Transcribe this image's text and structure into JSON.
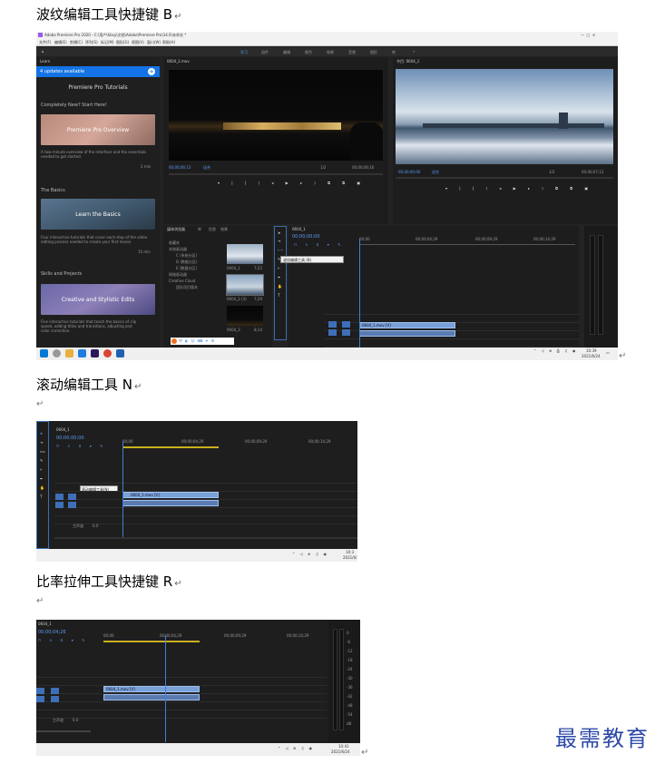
{
  "headings": {
    "first": "波纹编辑工具快捷键 B",
    "second": "滚动编辑工具 N",
    "third": "比率拉伸工具快捷键 R"
  },
  "para_mark": "↵",
  "screenshot1": {
    "window_title": "Adobe Premiere Pro 2020 - C:\\用户\\hbsy\\文档\\Adobe\\Premiere Pro\\14.0\\未命名 *",
    "menu": [
      "文件(F)",
      "编辑(E)",
      "剪辑(C)",
      "序列(S)",
      "标记(M)",
      "图形(G)",
      "视图(V)",
      "窗口(W)",
      "帮助(H)"
    ],
    "workspace_tabs": [
      "学习",
      "组件",
      "编辑",
      "颜色",
      "效果",
      "音频",
      "图形",
      "库"
    ],
    "learn_panel": {
      "tab": "Learn",
      "updates": "4 updates available",
      "title": "Premiere Pro Tutorials",
      "section1": "Completely New? Start Here!",
      "card1_title": "Premiere Pro Overview",
      "card1_desc": "A two-minute overview of the interface and the essentials needed to get started.",
      "card1_time": "2 min",
      "section2": "The Basics",
      "card2_title": "Learn the Basics",
      "card2_desc": "Four interactive tutorials that cover each step of the video editing process needed to create your first movie.",
      "card2_time": "15 min",
      "section3": "Skills and Projects",
      "card3_title": "Creative and Stylistic Edits",
      "card3_desc": "Five interactive tutorials that teach the basics of clip speed, adding titles and transitions, adjusting and color correction."
    },
    "source_monitor": {
      "tab": "0604_2.mov",
      "timecode_left": "00;00;06;13",
      "fit": "适合",
      "scale": "1/2",
      "timecode_right": "00;00;06;16"
    },
    "program_monitor": {
      "tab": "节目: 0604_1",
      "timecode_left": "00;00;00;00",
      "fit": "适合",
      "scale": "1/2",
      "timecode_right": "00;00;07;12"
    },
    "project_panel": {
      "tabs": [
        "媒体浏览器",
        "库",
        "信息",
        "效果"
      ],
      "items": [
        "收藏夹",
        "本地驱动器",
        "C (系统分区)",
        "D (数据分区)",
        "E (数据分区)",
        "网络驱动器",
        "Creative Cloud",
        "团队项目版本"
      ],
      "thumbs": [
        {
          "name": "0604_1",
          "duration": "7;22"
        },
        {
          "name": "0604_2 (3)",
          "duration": "7;29"
        },
        {
          "name": "0604_3",
          "duration": "8;14"
        }
      ]
    },
    "timeline": {
      "tab": "0604_1",
      "timecode": "00;00;00;00",
      "ruler": [
        "00;00",
        "00;00;04;29",
        "00;00;09;29",
        "00;00;14;29"
      ],
      "tooltip": "波纹编辑工具 (B)",
      "tracks": [
        "V3",
        "V2",
        "V1",
        "A1",
        "A2",
        "A3"
      ],
      "master": "主声道",
      "master_value": "0.0",
      "clip": "0604_1.mov [V]"
    },
    "taskbar": {
      "time": "10:39",
      "date": "2021/6/24"
    }
  },
  "screenshot2": {
    "tab": "0604_1",
    "timecode": "00;00;00;00",
    "ruler": [
      "00;00",
      "00;00;04;29",
      "00;00;09;29",
      "00;00;14;29"
    ],
    "tooltip": "滚动编辑工具(N)",
    "master": "主声道",
    "master_value": "0.0",
    "clip": "0604_1.mov [V]",
    "taskbar": {
      "time": "10:3",
      "date": "2021/6/"
    }
  },
  "screenshot3": {
    "tab": "0604_1",
    "timecode": "00;00;04;26",
    "ruler": [
      "00;00",
      "00;00;04;29",
      "00;00;09;29",
      "00;00;14;29"
    ],
    "master": "主声道",
    "master_value": "0.0",
    "clip": "0604_1.mov [V]",
    "meter_values": [
      "0",
      "-6",
      "-12",
      "-18",
      "-24",
      "-30",
      "-36",
      "-42",
      "-48",
      "-54",
      "dB"
    ],
    "taskbar": {
      "time": "10:41",
      "date": "2021/6/24"
    }
  },
  "watermark": "最需教育",
  "colors": {
    "accent_blue": "#3f7fd8",
    "panel_dark": "#1d1d1d",
    "clip_blue": "#7aa0d8",
    "logo_blue": "#2d4aa8"
  }
}
